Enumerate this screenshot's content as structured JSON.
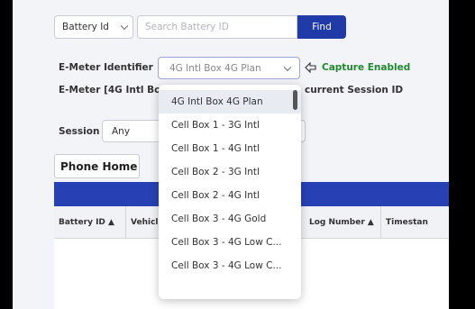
{
  "search": {
    "type_value": "Battery Id",
    "placeholder": "Search Battery ID",
    "find_label": "Find"
  },
  "emeter": {
    "identifier_label": "E-Meter Identifier",
    "selected": "4G Intl Box 4G Plan",
    "capture_status": "Capture Enabled",
    "second_line_start": "E-Meter [4G Intl Bo",
    "second_line_end": "current Session ID"
  },
  "session": {
    "label": "Session",
    "value": "Any"
  },
  "phone_home_label": "Phone Home",
  "table": {
    "columns": [
      "Battery ID ▲",
      "Vehicl",
      "",
      "Log Number ▲",
      "Timestan"
    ]
  },
  "dropdown": {
    "options": [
      "4G Intl Box 4G Plan",
      "Cell Box 1 - 3G Intl",
      "Cell Box 1 - 4G Intl",
      "Cell Box 2 - 3G Intl",
      "Cell Box 2 - 4G Intl",
      "Cell Box 3 - 4G Gold",
      "Cell Box 3 - 4G Low C...",
      "Cell Box 3 - 4G Low C..."
    ]
  },
  "colors": {
    "primary": "#203aa8",
    "capture_green": "#1f8a2e"
  }
}
